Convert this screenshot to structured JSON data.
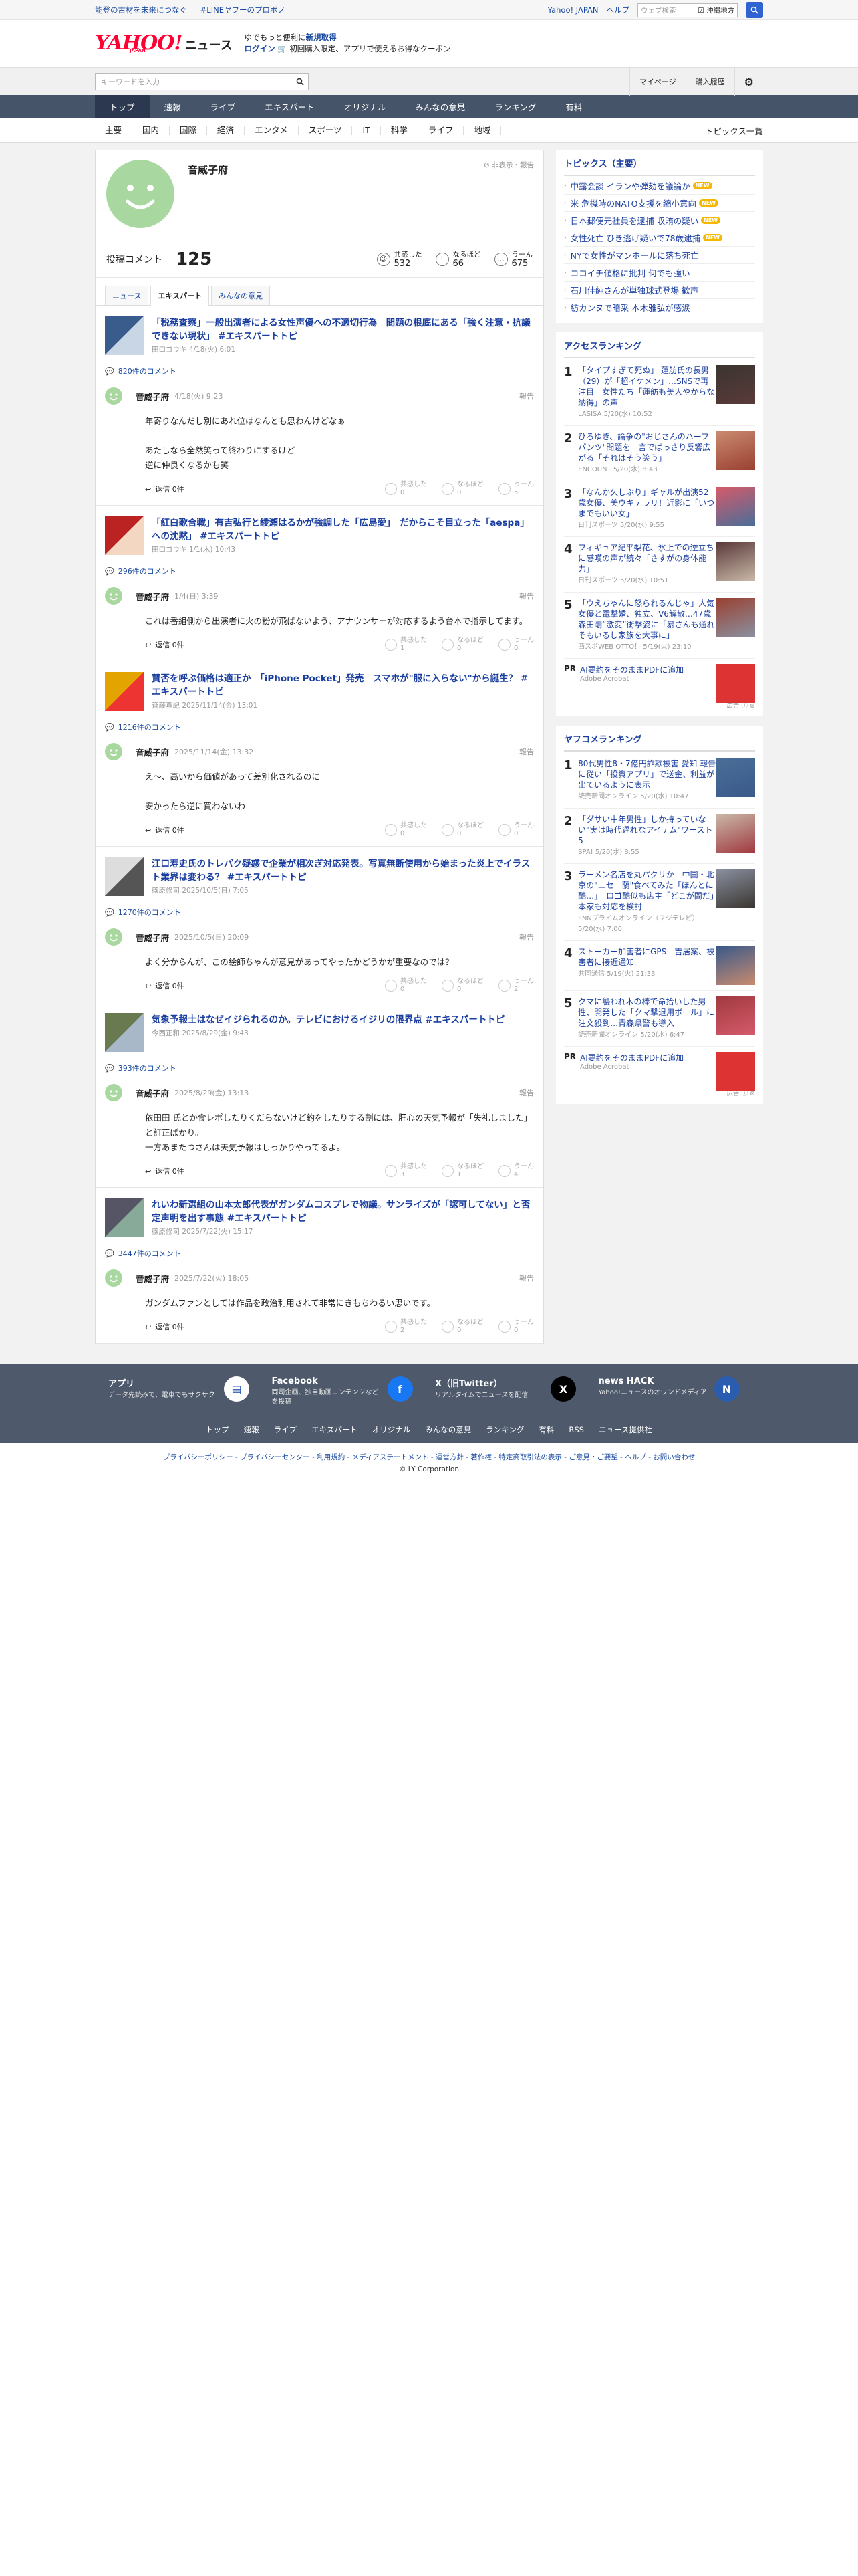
{
  "promo": {
    "left": [
      "能登の古材を未来につなぐ",
      "#LINEヤフーのプロボノ"
    ],
    "right_links": [
      "Yahoo! JAPAN",
      "ヘルプ"
    ],
    "search_placeholder": "ウェブ検索",
    "search_option": "沖縄地方"
  },
  "logo": {
    "yahoo": "YAHOO!",
    "japan": "JAPAN",
    "news": "ニュース"
  },
  "logo_msg": {
    "line1_a": "ゆでもっと便利に",
    "line1_b": "新規取得",
    "line2_a": "ログイン",
    "line2_b": "初回購入限定、アプリで使えるお得なクーポン"
  },
  "search": {
    "placeholder": "キーワードを入力",
    "mypage": "マイページ",
    "history": "購入履歴"
  },
  "nav": [
    "トップ",
    "速報",
    "ライブ",
    "エキスパート",
    "オリジナル",
    "みんなの意見",
    "ランキング",
    "有料"
  ],
  "subnav": [
    "主要",
    "国内",
    "国際",
    "経済",
    "エンタメ",
    "スポーツ",
    "IT",
    "科学",
    "ライフ",
    "地域"
  ],
  "subnav_all": "トピックス一覧",
  "profile": {
    "name": "音威子府",
    "report": "非表示・報告",
    "comment_label": "投稿コメント",
    "comment_count": "125",
    "reactions": [
      {
        "label": "共感した",
        "value": "532",
        "icon": "smile-icon"
      },
      {
        "label": "なるほど",
        "value": "66",
        "icon": "exclaim-icon"
      },
      {
        "label": "うーん",
        "value": "675",
        "icon": "hmm-icon"
      }
    ],
    "tabs": [
      "ニュース",
      "エキスパート",
      "みんなの意見"
    ]
  },
  "articles": [
    {
      "title": "「税務査察」一般出演者による女性声優への不適切行為　問題の根底にある「強く注意・抗議できない現状」 #エキスパートトピ",
      "source": "田口ゴウキ 4/18(火) 6:01",
      "comments": "820件のコメント",
      "comment": {
        "name": "音威子府",
        "date": "4/18(火) 9:23",
        "report": "報告",
        "body": "年寄りなんだし別にあれ位はなんとも思わんけどなぁ\n\nあたしなら全然笑って終わりにするけど\n逆に仲良くなるかも笑",
        "reply": "返信 0件",
        "r1": "共感した",
        "v1": "0",
        "r2": "なるほど",
        "v2": "0",
        "r3": "うーん",
        "v3": "5"
      }
    },
    {
      "title": "「紅白歌合戦」有吉弘行と綾瀬はるかが強調した「広島愛」　だからこそ目立った「aespa」への沈黙」 #エキスパートトピ",
      "source": "田口ゴウキ 1/1(木) 10:43",
      "comments": "296件のコメント",
      "comment": {
        "name": "音威子府",
        "date": "1/4(日) 3:39",
        "report": "報告",
        "body": "これは番組側から出演者に火の粉が飛ばないよう、アナウンサーが対応するよう台本で指示してます。",
        "reply": "返信 0件",
        "r1": "共感した",
        "v1": "1",
        "r2": "なるほど",
        "v2": "0",
        "r3": "うーん",
        "v3": "0"
      }
    },
    {
      "title": "賛否を呼ぶ価格は適正か　「iPhone Pocket」発売　スマホが\"服に入らない\"から誕生？ #エキスパートトピ",
      "source": "斉藤真紀 2025/11/14(金) 13:01",
      "comments": "1216件のコメント",
      "comment": {
        "name": "音威子府",
        "date": "2025/11/14(金) 13:32",
        "report": "報告",
        "body": "え〜、高いから価値があって差別化されるのに\n\n安かったら逆に買わないわ",
        "reply": "返信 0件",
        "r1": "共感した",
        "v1": "0",
        "r2": "なるほど",
        "v2": "0",
        "r3": "うーん",
        "v3": "0"
      }
    },
    {
      "title": "江口寿史氏のトレパク疑惑で企業が相次ぎ対応発表。写真無断使用から始まった炎上でイラスト業界は変わる？ #エキスパートトピ",
      "source": "篠原修司 2025/10/5(日) 7:05",
      "comments": "1270件のコメント",
      "comment": {
        "name": "音威子府",
        "date": "2025/10/5(日) 20:09",
        "report": "報告",
        "body": "よく分からんが、この絵師ちゃんが意見があってやったかどうかが重要なのでは？",
        "reply": "返信 0件",
        "r1": "共感した",
        "v1": "0",
        "r2": "なるほど",
        "v2": "0",
        "r3": "うーん",
        "v3": "2"
      }
    },
    {
      "title": "気象予報士はなぜイジられるのか。テレビにおけるイジリの限界点 #エキスパートトピ",
      "source": "今西正和 2025/8/29(金) 9:43",
      "comments": "393件のコメント",
      "comment": {
        "name": "音威子府",
        "date": "2025/8/29(金) 13:13",
        "report": "報告",
        "body": "依田田 氏とか食レポしたりくだらないけど釣をしたりする割には、肝心の天気予報が「失礼しました」と訂正ばかり。\n一方あまたつさんは天気予報はしっかりやってるよ。",
        "reply": "返信 0件",
        "r1": "共感した",
        "v1": "3",
        "r2": "なるほど",
        "v2": "1",
        "r3": "うーん",
        "v3": "4"
      }
    },
    {
      "title": "れいわ新選組の山本太郎代表がガンダムコスプレで物議。サンライズが「認可してない」と否定声明を出す事態 #エキスパートトピ",
      "source": "篠原修司 2025/7/22(火) 15:17",
      "comments": "3447件のコメント",
      "comment": {
        "name": "音威子府",
        "date": "2025/7/22(火) 18:05",
        "report": "報告",
        "body": "ガンダムファンとしては作品を政治利用されて非常にきもちわるい思いです。",
        "reply": "返信 0件",
        "r1": "共感した",
        "v1": "2",
        "r2": "なるほど",
        "v2": "0",
        "r3": "うーん",
        "v3": "0"
      }
    }
  ],
  "topics": {
    "heading": "トピックス（主要）",
    "items": [
      {
        "t": "中露会談 イランや弾劾を議論か",
        "new": true
      },
      {
        "t": "米 危機時のNATO支援を縮小意向",
        "new": true
      },
      {
        "t": "日本郵便元社員を逮捕 収賄の疑い",
        "new": true
      },
      {
        "t": "女性死亡 ひき逃げ疑いで78歳逮捕",
        "new": true
      },
      {
        "t": "NYで女性がマンホールに落ち死亡",
        "new": false
      },
      {
        "t": "ココイチ値格に批判 何でも強い",
        "new": false
      },
      {
        "t": "石川佳純さんが単独球式登場 歓声",
        "new": false
      },
      {
        "t": "紡カンヌで暗采 本木雅弘が感涙",
        "new": false
      }
    ],
    "new_label": "NEW"
  },
  "access_ranking": {
    "heading": "アクセスランキング",
    "items": [
      {
        "n": "1",
        "t": "「タイプすぎて死ぬ」 蓮舫氏の長男（29）が「超イケメン」…SNSで再注目　女性たち「蓮舫も美人やからな納得」の声",
        "s": "LASISA 5/20(水) 10:52"
      },
      {
        "n": "2",
        "t": "ひろゆき、論争の\"おじさんのハーフパンツ\"問題を一言でばっさり反響広がる「それはそう笑う」",
        "s": "ENCOUNT 5/20(水) 8:43"
      },
      {
        "n": "3",
        "t": "「なんか久しぶり」ギャルが出演52歳女優、美ウキテラリ！近影に「いつまでもいい女」",
        "s": "日刊スポーツ 5/20(水) 9:55"
      },
      {
        "n": "4",
        "t": "フィギュア紀平梨花、氷上での逆立ちに感嘆の声が続々「さすがの身体能力」",
        "s": "日刊スポーツ 5/20(水) 10:51"
      },
      {
        "n": "5",
        "t": "「ウえちゃんに怒られるんじゃ」人気女優と電撃婚、独立、V6解散…47歳森田剛“激変”衝撃姿に「暴さんも通れそもいるし家族を大事に」",
        "s": "西スポWEB OTTO！ 5/19(火) 23:10"
      }
    ]
  },
  "ads": [
    {
      "pr": "PR",
      "title": "AI要約をそのままPDFに追加",
      "adv": "Adobe Acrobat",
      "label": "広告"
    },
    {
      "pr": "PR",
      "title": "AI要約をそのままPDFに追加",
      "adv": "Adobe Acrobat",
      "label": "広告"
    }
  ],
  "yafuko_ranking": {
    "heading": "ヤフコメランキング",
    "items": [
      {
        "n": "1",
        "t": "80代男性8・7億円詐欺被害 愛知 報告に従い「投資アプリ」で送金、利益が出ているように表示",
        "s": "読売新聞オンライン 5/20(水) 10:47"
      },
      {
        "n": "2",
        "t": "「ダサい中年男性」しか持っていない\"実は時代遅れなアイテム\"ワースト5",
        "s": "SPA! 5/20(水) 8:55"
      },
      {
        "n": "3",
        "t": "ラーメン名店を丸パクリか　中国・北京の\"ニセ一蘭\"食べてみた「ほんとに酷…」　ロゴ酷似も店主「どこが問だ」　本家も対応を検討",
        "s": "FNNプライムオンライン（フジテレビ） 5/20(水) 7:00"
      },
      {
        "n": "4",
        "t": "ストーカー加害者にGPS　吉居案、被害者に接近通知",
        "s": "共同通信 5/19(火) 21:33"
      },
      {
        "n": "5",
        "t": "クマに襲われ木の棒で命拾いした男性、開発した「クマ撃退用ボール」に注文殺到…青森県警も導入",
        "s": "読売新聞オンライン 5/20(水) 6:47"
      }
    ]
  },
  "footer": {
    "apps": [
      {
        "title": "アプリ",
        "desc": "データ先読みで、電車でもサクサク",
        "icon": "phone-icon"
      },
      {
        "title": "Facebook",
        "desc": "両司企画、独自動画コンテンツなどを投稿",
        "icon": "facebook-icon"
      },
      {
        "title": "X（旧Twitter）",
        "desc": "リアルタイムでニュースを配信",
        "icon": "x-icon"
      },
      {
        "title": "news HACK",
        "desc": "Yahoo!ニュースのオウンドメディア",
        "icon": "newshack-icon"
      }
    ],
    "links": [
      "トップ",
      "速報",
      "ライブ",
      "エキスパート",
      "オリジナル",
      "みんなの意見",
      "ランキング",
      "有料",
      "RSS",
      "ニュース提供社"
    ],
    "legal": "プライバシーポリシー - プライバシーセンター - 利用規約 - メディアステートメント - 運営方針 - 著作権 - 特定商取引法の表示 - ご意見・ご要望 - ヘルプ - お問い合わせ",
    "copyright": "© LY Corporation"
  }
}
